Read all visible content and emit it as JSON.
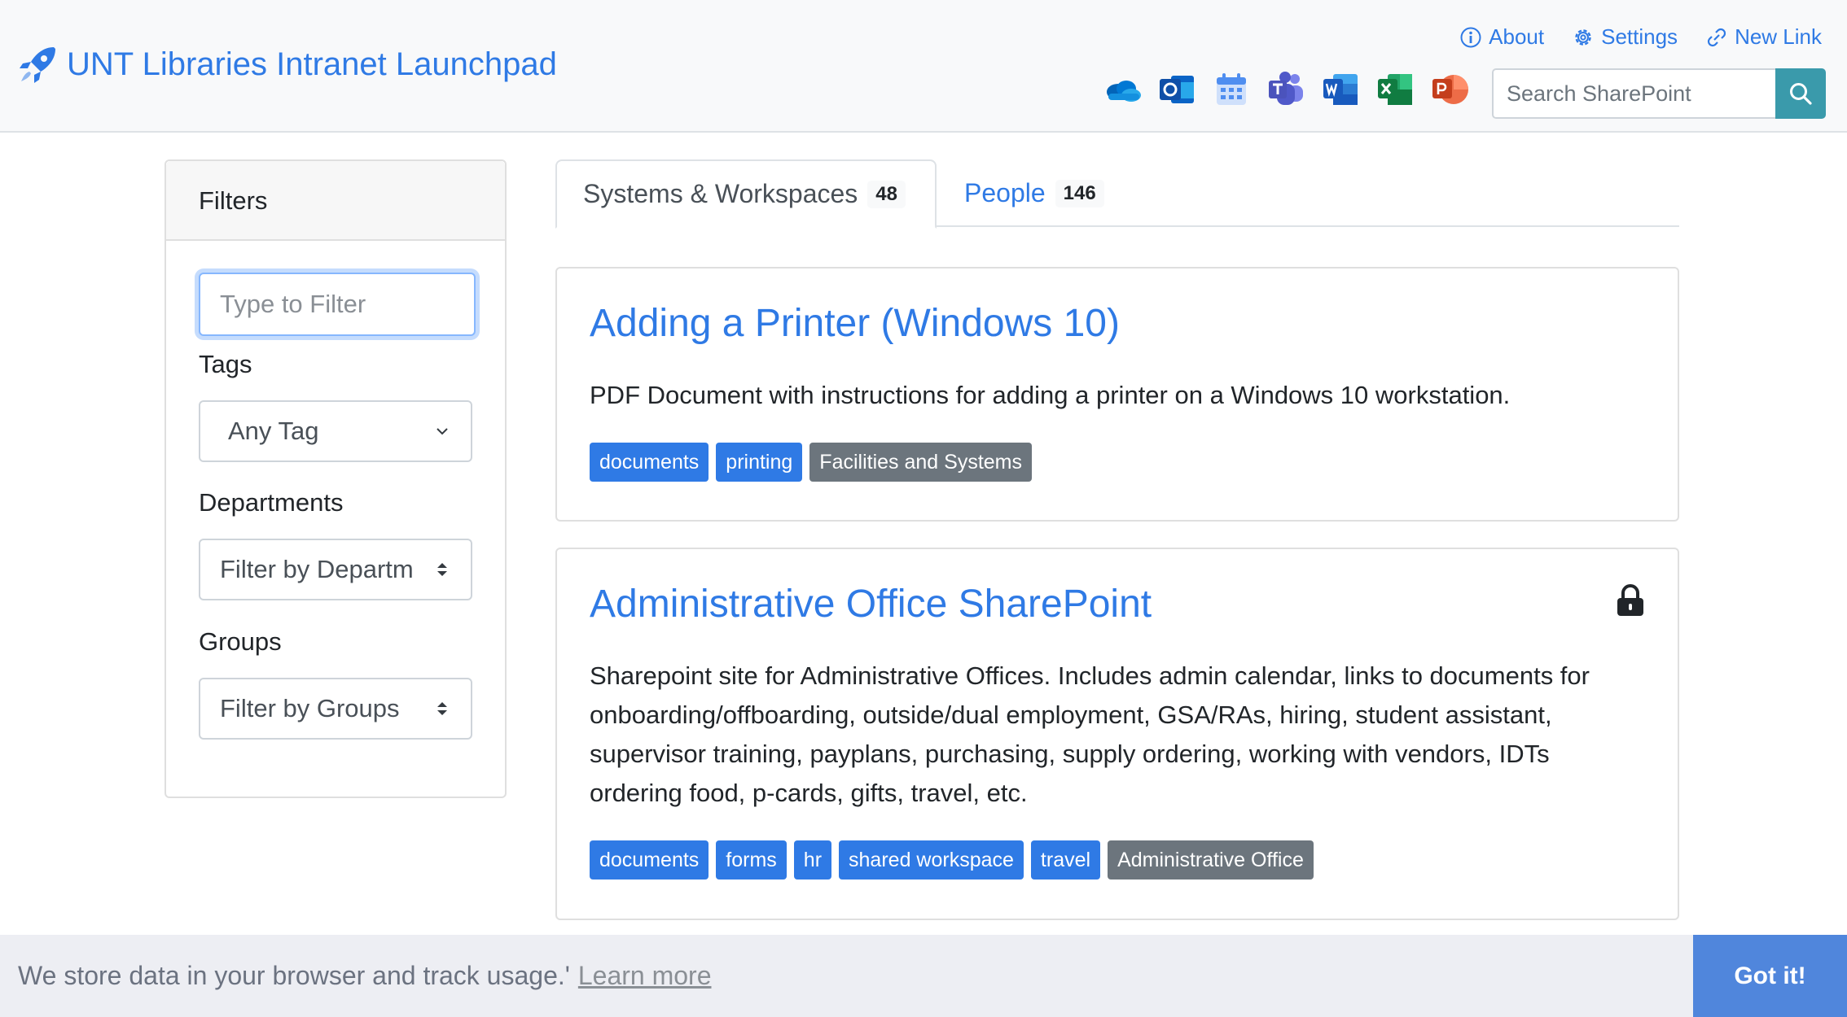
{
  "header": {
    "title": "UNT Libraries Intranet Launchpad",
    "links": {
      "about": "About",
      "settings": "Settings",
      "new_link": "New Link"
    },
    "apps": [
      "onedrive-icon",
      "outlook-icon",
      "calendar-icon",
      "teams-icon",
      "word-icon",
      "excel-icon",
      "powerpoint-icon"
    ],
    "search": {
      "placeholder": "Search SharePoint"
    }
  },
  "sidebar": {
    "heading": "Filters",
    "filter_placeholder": "Type to Filter",
    "tags_label": "Tags",
    "tags_value": "Any Tag",
    "departments_label": "Departments",
    "departments_value": "Filter by Departm",
    "groups_label": "Groups",
    "groups_value": "Filter by Groups"
  },
  "tabs": [
    {
      "label": "Systems & Workspaces",
      "count": "48",
      "active": true
    },
    {
      "label": "People",
      "count": "146",
      "active": false
    }
  ],
  "cards": [
    {
      "title": "Adding a Printer (Windows 10)",
      "description": "PDF Document with instructions for adding a printer on a Windows 10 workstation.",
      "tags": [
        "documents",
        "printing"
      ],
      "department": "Facilities and Systems",
      "locked": false
    },
    {
      "title": "Administrative Office SharePoint",
      "description": "Sharepoint site for Administrative Offices. Includes admin calendar, links to documents for onboarding/offboarding, outside/dual employment, GSA/RAs, hiring, student assistant, supervisor training, payplans, purchasing, supply ordering, working with vendors, IDTs ordering food, p-cards, gifts, travel, etc.",
      "tags": [
        "documents",
        "forms",
        "hr",
        "shared workspace",
        "travel"
      ],
      "department": "Administrative Office",
      "locked": true
    }
  ],
  "cookie": {
    "message": "We store data in your browser and track usage.'",
    "learn_more": "Learn more",
    "button": "Got it!"
  },
  "colors": {
    "primary": "#2f7ae5",
    "department_tag": "#6c757d",
    "search_button": "#3a9aab",
    "cookie_button": "#5086dc"
  }
}
